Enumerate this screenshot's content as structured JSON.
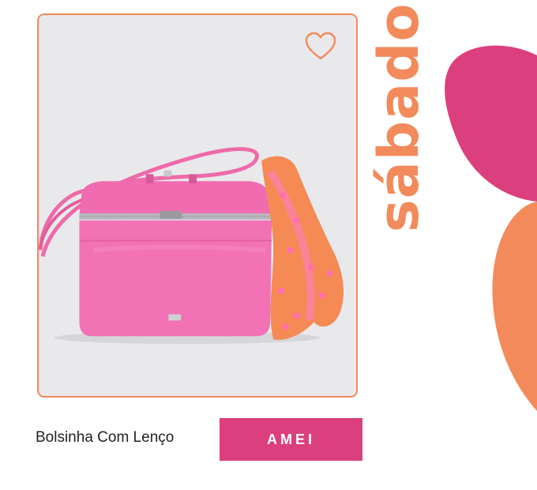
{
  "day": {
    "label": "sábado"
  },
  "product": {
    "name": "Bolsinha Com Lenço",
    "image_alt": "Bolsinha Com Lenço",
    "favorite_icon": "heart-outline-icon"
  },
  "actions": {
    "amei_label": "AMEI"
  },
  "colors": {
    "accent_orange": "#f38a5c",
    "brand_pink": "#dc3f7d",
    "bag_pink": "#f06bb0",
    "card_bg": "#e9e9eb"
  }
}
